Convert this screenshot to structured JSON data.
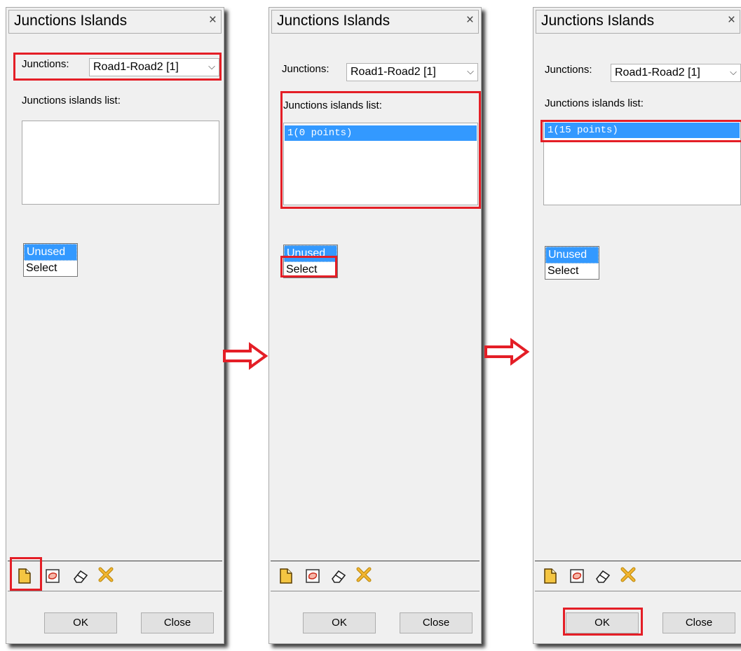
{
  "panels": [
    {
      "title": "Junctions Islands",
      "close_glyph": "×",
      "junctions_label": "Junctions:",
      "junctions_value": "Road1-Road2 [1]",
      "list_label": "Junctions islands list:",
      "islands": [],
      "modes": [
        "Unused",
        "Select"
      ],
      "selected_mode": "Unused",
      "toolbar_icons": [
        "new-island-icon",
        "draw-island-icon",
        "erase-icon",
        "delete-icon"
      ],
      "ok_label": "OK",
      "close_label": "Close"
    },
    {
      "title": "Junctions Islands",
      "close_glyph": "×",
      "junctions_label": "Junctions:",
      "junctions_value": "Road1-Road2 [1]",
      "list_label": "Junctions islands list:",
      "islands": [
        "1(0 points)"
      ],
      "modes": [
        "Unused",
        "Select"
      ],
      "selected_mode": "Unused",
      "toolbar_icons": [
        "new-island-icon",
        "draw-island-icon",
        "erase-icon",
        "delete-icon"
      ],
      "ok_label": "OK",
      "close_label": "Close"
    },
    {
      "title": "Junctions Islands",
      "close_glyph": "×",
      "junctions_label": "Junctions:",
      "junctions_value": "Road1-Road2 [1]",
      "list_label": "Junctions islands list:",
      "islands": [
        "1(15 points)"
      ],
      "modes": [
        "Unused",
        "Select"
      ],
      "selected_mode": "Unused",
      "toolbar_icons": [
        "new-island-icon",
        "draw-island-icon",
        "erase-icon",
        "delete-icon"
      ],
      "ok_label": "OK",
      "close_label": "Close"
    }
  ],
  "colors": {
    "highlight": "#e41e26",
    "selection": "#3399ff",
    "panel_bg": "#f0f0f0",
    "button_bg": "#e1e1e1"
  },
  "icons": {
    "arrow": "right-arrow-icon",
    "chevron": "chevron-down-icon",
    "close": "close-icon"
  }
}
